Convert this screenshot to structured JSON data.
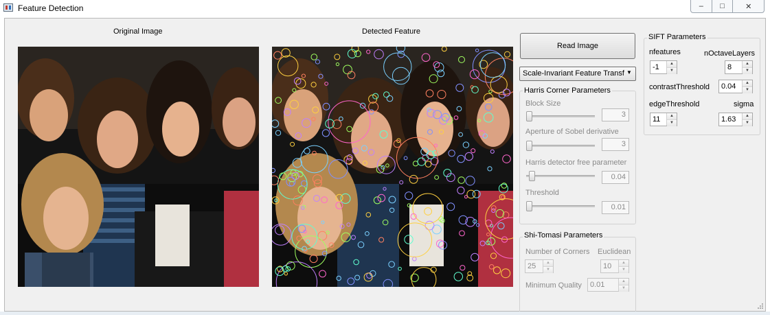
{
  "window": {
    "title": "Feature Detection",
    "minimize": "–",
    "maximize": "□",
    "close": "✕"
  },
  "panels": {
    "original_title": "Original Image",
    "detected_title": "Detected Feature"
  },
  "controls": {
    "read_image": "Read Image",
    "algorithm_selected": "Scale-Invariant Feature Transf"
  },
  "harris": {
    "title": "Harris Corner Parameters",
    "block_size_label": "Block Size",
    "block_size_value": "3",
    "block_size_level": 0.0,
    "aperture_label": "Aperture  of  Sobel derivative",
    "aperture_value": "3",
    "aperture_level": 0.0,
    "free_param_label": "Harris detector free parameter",
    "free_param_value": "0.04",
    "free_param_level": 0.04,
    "threshold_label": "Threshold",
    "threshold_value": "0.01",
    "threshold_level": 0.0
  },
  "shitomasi": {
    "title": "Shi-Tomasi Parameters",
    "corners_label": "Number of Corners",
    "corners_value": "25",
    "euclidean_label": "Euclidean",
    "euclidean_value": "10",
    "quality_label": "Minimum Quality",
    "quality_value": "0.01"
  },
  "sift": {
    "title": "SIFT Parameters",
    "nfeatures_label": "nfeatures",
    "nfeatures_value": "-1",
    "noctave_label": "nOctaveLayers",
    "noctave_value": "8",
    "contrast_label": "contrastThreshold",
    "contrast_value": "0.04",
    "edge_label": "edgeThreshold",
    "edge_value": "11",
    "sigma_label": "sigma",
    "sigma_value": "1.63"
  },
  "icons": {
    "dropdown": "chevron-down-icon",
    "spin_up": "▲",
    "spin_down": "▼"
  }
}
